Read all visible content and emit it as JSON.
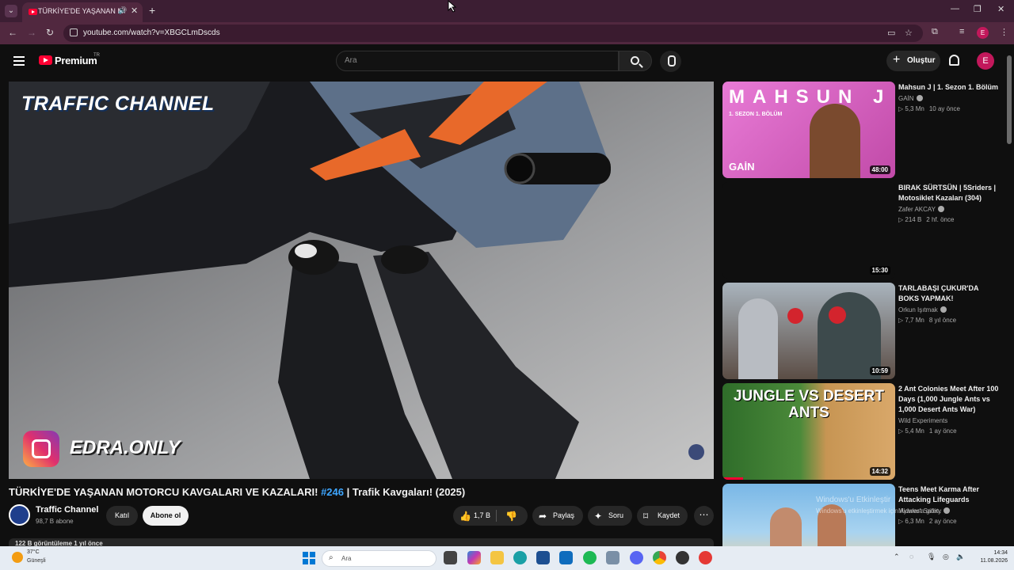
{
  "browser": {
    "tab_title": "TÜRKİYE'DE YAŞANAN MOTORCU KAVGALARI",
    "url": "youtube.com/watch?v=XBGCLmDscds",
    "profile_initial": "E"
  },
  "header": {
    "brand": "Premium",
    "country": "TR",
    "search_placeholder": "Ara",
    "create_label": "Oluştur",
    "avatar_initial": "E"
  },
  "player": {
    "watermark": "TRAFFIC CHANNEL",
    "instagram_handle": "EDRA.ONLY"
  },
  "video": {
    "title_prefix": "TÜRKİYE'DE YAŞANAN MOTORCU KAVGALARI VE KAZALARI! ",
    "title_tag": "#246",
    "title_suffix": " | Trafik Kavgaları! (2025)",
    "channel_name": "Traffic Channel",
    "subscribers": "98,7 B abone",
    "join_label": "Katıl",
    "subscribe_label": "Abone ol",
    "likes": "1,7 B",
    "share_label": "Paylaş",
    "ask_label": "Soru",
    "save_label": "Kaydet",
    "description_peek": "122 B görüntüleme  1 yıl önce"
  },
  "recommendations": [
    {
      "title": "Mahsun J | 1. Sezon 1. Bölüm",
      "channel": "GAİN",
      "views": "5,3 Mn",
      "age": "10 ay önce",
      "duration": "48:00",
      "thumb_text": "MAHSUN J",
      "thumb_sub": "1. SEZON 1. BÖLÜM",
      "thumb_logo": "GAİN"
    },
    {
      "title": "BIRAK SÜRTSÜN | 5Sriders | Motosiklet Kazaları (304)",
      "channel": "Zafer AKCAY",
      "views": "214 B",
      "age": "2 hf. önce",
      "duration": "15:30"
    },
    {
      "title": "TARLABAŞI ÇUKUR'DA BOKS YAPMAK!",
      "channel": "Orkun Işıtmak",
      "views": "7,7 Mn",
      "age": "8 yıl önce",
      "duration": "10:59"
    },
    {
      "title": "2 Ant Colonies Meet After 100 Days (1,000 Jungle Ants vs 1,000 Desert Ants War)",
      "channel": "Wild Experiments",
      "views": "5,4 Mn",
      "age": "1 ay önce",
      "duration": "14:32",
      "thumb_text": "JUNGLE VS DESERT ANTS",
      "watch_progress": 0.12
    },
    {
      "title": "Teens Meet Karma After Attacking Lifeguards",
      "channel": "Midwest Safety",
      "views": "6,3 Mn",
      "age": "2 ay önce"
    }
  ],
  "overlay": {
    "activate_line1": "Windows'u Etkinleştir",
    "activate_line2": "Windows'u etkinleştirmek için Ayarlar'a gidin."
  },
  "taskbar": {
    "temperature": "37°C",
    "location": "Güneşli",
    "search_label": "Ara",
    "time": "14:34",
    "date": "11.08.2026"
  },
  "colors": {
    "accent_red": "#ff0033",
    "link_blue": "#3ea6ff",
    "tab_bg": "#51283f"
  }
}
